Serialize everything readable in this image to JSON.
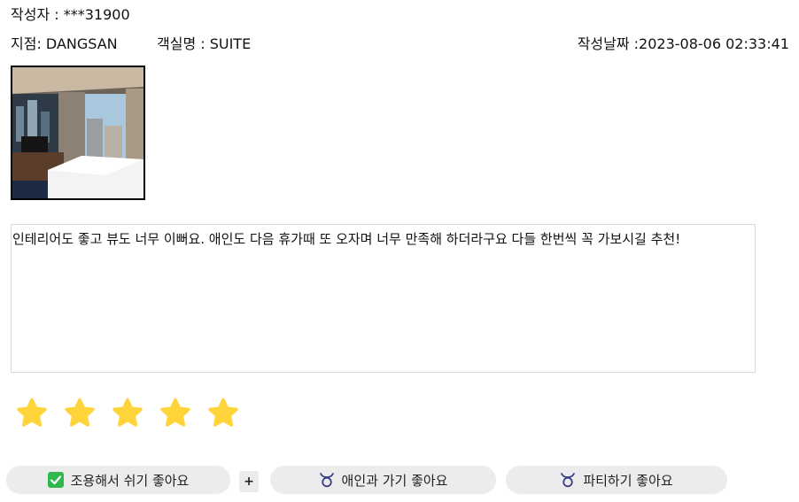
{
  "review": {
    "author": "작성자 : ***31900",
    "branch": "지점: DANGSAN",
    "room": "객실명 : SUITE",
    "date": "작성날짜 :2023-08-06 02:33:41",
    "text": "인테리어도 좋고 뷰도 너무 이뻐요. 애인도 다음 휴가때 또 오자며 너무 만족해 하더라구요 다들 한번씩 꼭 가보시길 추천!",
    "rating": 5,
    "photo_icon": "hotel-room-photo"
  },
  "tags": [
    {
      "label": "조용해서 쉬기 좋아요",
      "icon": "checkbox-checked-icon",
      "selected": true
    },
    {
      "label": "애인과 가기 좋아요",
      "icon": "taurus-icon",
      "selected": false
    },
    {
      "label": "파티하기 좋아요",
      "icon": "taurus-icon",
      "selected": false
    }
  ],
  "plus_label": "+",
  "colors": {
    "star": "#ffd43b",
    "check": "#2fb84d",
    "tag_bg": "#ececec",
    "tag_icon": "#3c3c8c"
  }
}
